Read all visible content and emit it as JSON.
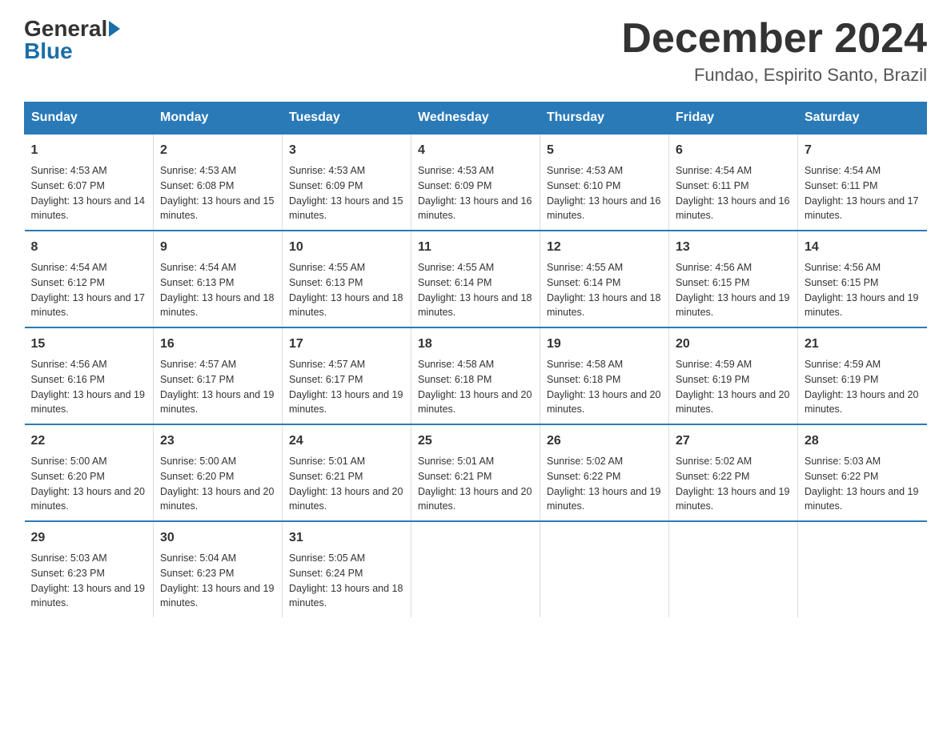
{
  "header": {
    "logo_general": "General",
    "logo_blue": "Blue",
    "month_title": "December 2024",
    "location": "Fundao, Espirito Santo, Brazil"
  },
  "days_of_week": [
    "Sunday",
    "Monday",
    "Tuesday",
    "Wednesday",
    "Thursday",
    "Friday",
    "Saturday"
  ],
  "weeks": [
    [
      {
        "day": "1",
        "sunrise": "4:53 AM",
        "sunset": "6:07 PM",
        "daylight": "13 hours and 14 minutes."
      },
      {
        "day": "2",
        "sunrise": "4:53 AM",
        "sunset": "6:08 PM",
        "daylight": "13 hours and 15 minutes."
      },
      {
        "day": "3",
        "sunrise": "4:53 AM",
        "sunset": "6:09 PM",
        "daylight": "13 hours and 15 minutes."
      },
      {
        "day": "4",
        "sunrise": "4:53 AM",
        "sunset": "6:09 PM",
        "daylight": "13 hours and 16 minutes."
      },
      {
        "day": "5",
        "sunrise": "4:53 AM",
        "sunset": "6:10 PM",
        "daylight": "13 hours and 16 minutes."
      },
      {
        "day": "6",
        "sunrise": "4:54 AM",
        "sunset": "6:11 PM",
        "daylight": "13 hours and 16 minutes."
      },
      {
        "day": "7",
        "sunrise": "4:54 AM",
        "sunset": "6:11 PM",
        "daylight": "13 hours and 17 minutes."
      }
    ],
    [
      {
        "day": "8",
        "sunrise": "4:54 AM",
        "sunset": "6:12 PM",
        "daylight": "13 hours and 17 minutes."
      },
      {
        "day": "9",
        "sunrise": "4:54 AM",
        "sunset": "6:13 PM",
        "daylight": "13 hours and 18 minutes."
      },
      {
        "day": "10",
        "sunrise": "4:55 AM",
        "sunset": "6:13 PM",
        "daylight": "13 hours and 18 minutes."
      },
      {
        "day": "11",
        "sunrise": "4:55 AM",
        "sunset": "6:14 PM",
        "daylight": "13 hours and 18 minutes."
      },
      {
        "day": "12",
        "sunrise": "4:55 AM",
        "sunset": "6:14 PM",
        "daylight": "13 hours and 18 minutes."
      },
      {
        "day": "13",
        "sunrise": "4:56 AM",
        "sunset": "6:15 PM",
        "daylight": "13 hours and 19 minutes."
      },
      {
        "day": "14",
        "sunrise": "4:56 AM",
        "sunset": "6:15 PM",
        "daylight": "13 hours and 19 minutes."
      }
    ],
    [
      {
        "day": "15",
        "sunrise": "4:56 AM",
        "sunset": "6:16 PM",
        "daylight": "13 hours and 19 minutes."
      },
      {
        "day": "16",
        "sunrise": "4:57 AM",
        "sunset": "6:17 PM",
        "daylight": "13 hours and 19 minutes."
      },
      {
        "day": "17",
        "sunrise": "4:57 AM",
        "sunset": "6:17 PM",
        "daylight": "13 hours and 19 minutes."
      },
      {
        "day": "18",
        "sunrise": "4:58 AM",
        "sunset": "6:18 PM",
        "daylight": "13 hours and 20 minutes."
      },
      {
        "day": "19",
        "sunrise": "4:58 AM",
        "sunset": "6:18 PM",
        "daylight": "13 hours and 20 minutes."
      },
      {
        "day": "20",
        "sunrise": "4:59 AM",
        "sunset": "6:19 PM",
        "daylight": "13 hours and 20 minutes."
      },
      {
        "day": "21",
        "sunrise": "4:59 AM",
        "sunset": "6:19 PM",
        "daylight": "13 hours and 20 minutes."
      }
    ],
    [
      {
        "day": "22",
        "sunrise": "5:00 AM",
        "sunset": "6:20 PM",
        "daylight": "13 hours and 20 minutes."
      },
      {
        "day": "23",
        "sunrise": "5:00 AM",
        "sunset": "6:20 PM",
        "daylight": "13 hours and 20 minutes."
      },
      {
        "day": "24",
        "sunrise": "5:01 AM",
        "sunset": "6:21 PM",
        "daylight": "13 hours and 20 minutes."
      },
      {
        "day": "25",
        "sunrise": "5:01 AM",
        "sunset": "6:21 PM",
        "daylight": "13 hours and 20 minutes."
      },
      {
        "day": "26",
        "sunrise": "5:02 AM",
        "sunset": "6:22 PM",
        "daylight": "13 hours and 19 minutes."
      },
      {
        "day": "27",
        "sunrise": "5:02 AM",
        "sunset": "6:22 PM",
        "daylight": "13 hours and 19 minutes."
      },
      {
        "day": "28",
        "sunrise": "5:03 AM",
        "sunset": "6:22 PM",
        "daylight": "13 hours and 19 minutes."
      }
    ],
    [
      {
        "day": "29",
        "sunrise": "5:03 AM",
        "sunset": "6:23 PM",
        "daylight": "13 hours and 19 minutes."
      },
      {
        "day": "30",
        "sunrise": "5:04 AM",
        "sunset": "6:23 PM",
        "daylight": "13 hours and 19 minutes."
      },
      {
        "day": "31",
        "sunrise": "5:05 AM",
        "sunset": "6:24 PM",
        "daylight": "13 hours and 18 minutes."
      },
      {
        "day": "",
        "sunrise": "",
        "sunset": "",
        "daylight": ""
      },
      {
        "day": "",
        "sunrise": "",
        "sunset": "",
        "daylight": ""
      },
      {
        "day": "",
        "sunrise": "",
        "sunset": "",
        "daylight": ""
      },
      {
        "day": "",
        "sunrise": "",
        "sunset": "",
        "daylight": ""
      }
    ]
  ]
}
